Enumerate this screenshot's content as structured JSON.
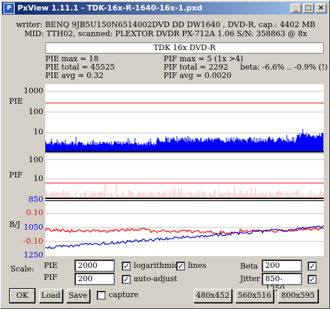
{
  "window": {
    "title": "PxView 1.11.1 - TDK-16x-R-1640-16x-1.pxd",
    "app_icon": "pxview-app-icon",
    "minimize_label": "_",
    "maximize_label": "□",
    "close_label": "×"
  },
  "info": {
    "line1": "writer: BENQ 9JB5U150N6514002DVD DD DW1640 , DVD-R, cap.: 4402 MB",
    "line2": "MID: TTH02, scanned: PLEXTOR DVDR PX-712A 1.06 S/N: 358863 @ 8x"
  },
  "disc_label": "TDK 16x DVD-R",
  "stats": {
    "pie_max": "PIE max = 18",
    "pie_total": "PIE total = 45525",
    "pie_avg": "PIE avg = 0.32",
    "pif_max": "PIF max = 5 (1x >4)",
    "pif_total": "PIF total = 2292",
    "pif_avg": "PIF avg = 0.0020",
    "beta": "beta: -6.6% .. -0.9% (!)"
  },
  "axes": {
    "pie_title": "PIE",
    "pie_ticks": [
      "1000",
      "100",
      "10"
    ],
    "pif_title": "PIF",
    "pif_ticks": [
      "100",
      "10"
    ],
    "bj_title": "B/J",
    "bj_ticks": [
      "850",
      "0.10",
      "1050",
      "-0.10",
      "1250"
    ]
  },
  "colors": {
    "pie": "#0000ff",
    "pif": "#ff4040",
    "beta": "#ff0000",
    "jitter": "#0000c0",
    "limit": "#ff0000",
    "tick_blue": "#0000ff",
    "tick_red": "#ff0000"
  },
  "scale": {
    "label": "Scale:",
    "pie_label": "PIE",
    "pie_value": "2000",
    "pif_label": "PIF",
    "pif_value": "200",
    "logarithmic_label": "logarithmic",
    "logarithmic_checked": "✓",
    "lines_label": "lines",
    "lines_checked": "✓",
    "auto_adjust_label": "auto-adjust",
    "auto_adjust_checked": "✓",
    "beta_label": "Beta",
    "beta_value": "200",
    "beta_checked": "✓",
    "jitter_label": "Jitter",
    "jitter_value": "850-1250",
    "jitter_checked": "✓"
  },
  "buttons": {
    "ok": "OK",
    "load": "Load",
    "save": "Save",
    "capture_label": "capture",
    "size1": "480x452",
    "size2": "560x516",
    "size3": "800x595"
  }
}
